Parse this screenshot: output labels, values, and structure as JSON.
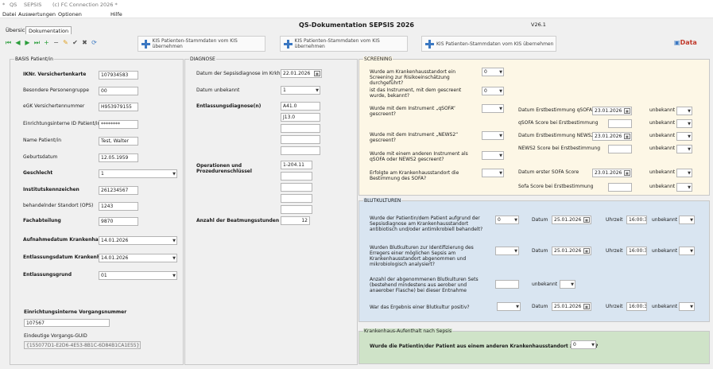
{
  "window": {
    "title_parts": [
      "*",
      "QS",
      "SEPSIS",
      "(c) FC Connection 2026 *"
    ]
  },
  "menu": [
    "Datei",
    "Auswertungen",
    "Optionen",
    "Hilfe"
  ],
  "app": {
    "title": "QS-Dokumentation SEPSIS 2026",
    "version": "V26.1"
  },
  "tabs": [
    "Übersicht",
    "Dokumentation"
  ],
  "toolbar_buttons": {
    "b1": "KIS Patienten-Stammdaten vom KIS übernehmen",
    "b2": "KIS Patienten-Stammdaten vom KIS übernehmen",
    "b3": "KIS Patienten-Stammdaten vom KIS übernehmen"
  },
  "logo_text": "Data",
  "basis": {
    "legend": "BASIS Patient/in",
    "rows": [
      {
        "label": "IKNr. Versichertenkarte",
        "value": "107934583"
      },
      {
        "label": "Besondere Personengruppe",
        "value": "00"
      },
      {
        "label": "eGK Versichertennummer",
        "value": "H953979155"
      },
      {
        "label": "Einrichtungsinterne ID Patient/in",
        "value": "********"
      },
      {
        "label": "Name Patient/in",
        "value": "Test, Walter"
      },
      {
        "label": "Geburtsdatum",
        "value": "12.05.1959"
      },
      {
        "label": "Geschlecht",
        "value": "1"
      },
      {
        "label": "Institutskennzeichen",
        "value": "261234567"
      },
      {
        "label": "behandelnder Standort (OPS)",
        "value": "1243"
      },
      {
        "label": "Fachabteilung",
        "value": "9870"
      },
      {
        "label": "Aufnahmedatum Krankenhaus",
        "value": "14.01.2026"
      },
      {
        "label": "Entlassungsdatum Krankenhaus",
        "value": "14.01.2026"
      },
      {
        "label": "Entlassungsgrund",
        "value": "01"
      }
    ],
    "vorgang_label": "Einrichtungsinterne Vorgangsnummer",
    "vorgang_value": "107567",
    "guid_label": "Eindeutige Vorgangs-GUID",
    "guid_value": "{155077D1-E2D6-4E53-8B1C-6D84B1CA1E55}"
  },
  "diagnose": {
    "legend": "DIAGNOSE",
    "datum_label": "Datum der Sepsisdiagnose im Krkh.",
    "datum_value": "22.01.2026",
    "uhrzeit_label": "Datum unbekannt",
    "uhrzeit_value": "1",
    "entl_label": "Entlassungsdiagnose(n)",
    "entl_values": [
      "A41.0",
      "J13.0",
      "",
      "",
      ""
    ],
    "ops_label": "Operationen und Prozedurenschlüssel",
    "ops_values": [
      "1-204.11",
      "",
      "",
      "",
      ""
    ],
    "beatm_label": "Anzahl der Beatmungsstunden",
    "beatm_value": "12"
  },
  "screening": {
    "legend": "SCREENING",
    "q1": "Wurde am Krankenhausstandort ein Screening zur Risikoeinschätzung durchgeführt?",
    "q1_value": "0",
    "q2": "ist das Instrument, mit dem gescreent wurde, bekannt?",
    "q2_value": "0",
    "q3": "Wurde mit dem Instrument „qSOFA“ gescreent?",
    "q4": "Wurde mit dem Instrument „NEWS2“ gescreent?",
    "q5": "Wurde mit einem anderen Instrument als qSOFA oder NEWS2 gescreent?",
    "q6": "Erfolgte am Krankenhausstandort die Bestimmung des SOFA?",
    "r1": "Datum Erstbestimmung qSOFA",
    "r1_value": "23.01.2026",
    "r2": "qSOFA Score bei Erstbestimmung",
    "r3": "Datum Erstbestimmung NEWS2",
    "r3_value": "23.01.2026",
    "r4": "NEWS2 Score bei Erstbestimmung",
    "r5": "Datum erster SOFA Score",
    "r5_value": "23.01.2026",
    "r6": "Sofa Score bei Erstbestimmung",
    "unbekannt": "unbekannt"
  },
  "blut": {
    "legend": "BLUTKULTUREN",
    "q1": "Wurde der Patientin/dem Patient aufgrund der Sepsisdiagnose am Krankenhausstandort antibiotisch und/oder antimikrobiell behandelt?",
    "q1_value": "0",
    "q2": "Wurden Blutkulturen zur Identifizierung des Erregers einer möglichen Sepsis am Krankenhausstandort abgenommen und mikrobiologisch analysiert?",
    "q3": "Anzahl der abgenommenen Blutkulturen Sets (bestehend mindestens aus aerober und anaerober Flasche) bei dieser Entnahme",
    "q4": "War das Ergebnis einer Blutkultur positiv?",
    "datum_label": "Datum",
    "uhrzeit_label": "Uhrzeit",
    "unbekannt": "unbekannt",
    "d1": "25.01.2026",
    "t1": "16:00:30",
    "d2": "25.01.2026",
    "t2": "16:00:30",
    "d4": "25.01.2026",
    "t4": "16:00:30"
  },
  "krankenhaus": {
    "legend": "Krankenhaus-Aufenthalt nach Sepsis",
    "q1": "Wurde die Patientin/der Patient aus einem anderen Krankenhausstandort zuverlegt?",
    "q1_value": "0"
  },
  "colors": {
    "screening_bg": "#fdf7e6",
    "blut_bg": "#d9e5f1",
    "kh_bg": "#cfe3c8",
    "accent": "#3b78c2"
  }
}
